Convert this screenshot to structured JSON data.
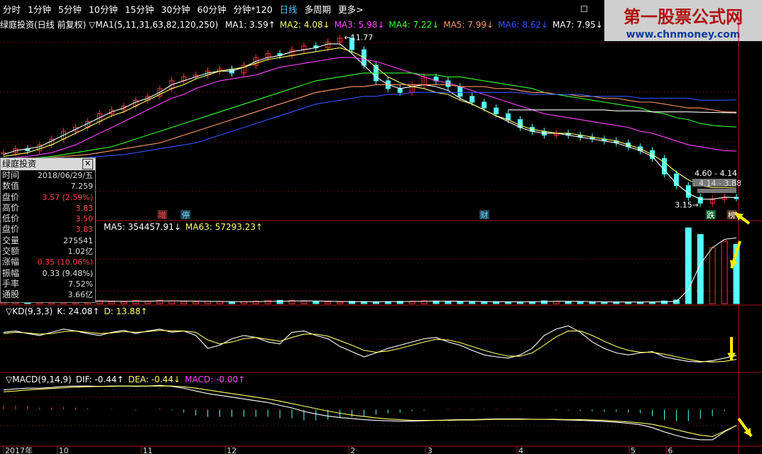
{
  "toolbar": {
    "items": [
      "分时",
      "1分钟",
      "5分钟",
      "10分钟",
      "15分钟",
      "30分钟",
      "60分钟",
      "分钟*120",
      "日线",
      "多周期",
      "更多>"
    ],
    "active": "日线"
  },
  "watermark": {
    "line1": "第一股票公式网",
    "line2": "www.chnmoney.com"
  },
  "main_header": {
    "title": "绿庭投资(日线 前复权)",
    "params": "MA1(5,11,31,63,82,120,250)",
    "ma_labels": [
      {
        "text": "MA1: 3.59↑",
        "color": "#ffffff"
      },
      {
        "text": "MA2: 4.08↓",
        "color": "#ffff66"
      },
      {
        "text": "MA3: 5.98↓",
        "color": "#ff44ff"
      },
      {
        "text": "MA4: 7.22↓",
        "color": "#33ff33"
      },
      {
        "text": "MA5: 7.99↓",
        "color": "#ff9966"
      },
      {
        "text": "MA6: 8.62↓",
        "color": "#3355ff"
      },
      {
        "text": "MA7: 7.95↓",
        "color": "#ffffff"
      }
    ]
  },
  "price_annotations": {
    "high": "11.77",
    "low": "3.15",
    "zone1": "4.60 - 4.14",
    "zone2": "4.14 - 3.88"
  },
  "events": [
    {
      "text": "增",
      "color": "#ff4444",
      "bg": "#552222",
      "x": 3.4
    },
    {
      "text": "停",
      "color": "#66ddff",
      "bg": "#224455",
      "x": 3.9
    },
    {
      "text": "财",
      "color": "#66ddff",
      "bg": "#224455",
      "x": 10.3
    },
    {
      "text": "跌",
      "color": "#ffffff",
      "bg": "#116633",
      "x": 15.15
    },
    {
      "text": "榜",
      "color": "#ffffff",
      "bg": "#553322",
      "x": 15.6
    }
  ],
  "infobox": {
    "title": "绿庭投资",
    "rows": [
      {
        "label": "时间",
        "value": "2018/06/29/五",
        "red": false
      },
      {
        "label": "数值",
        "value": "7.259",
        "red": false
      },
      {
        "label": "盘价",
        "value": "3.57 (2.59%)",
        "red": true
      },
      {
        "label": "高价",
        "value": "3.83",
        "red": true
      },
      {
        "label": "低价",
        "value": "3.50",
        "red": true
      },
      {
        "label": "盘价",
        "value": "3.83",
        "red": true
      },
      {
        "label": "交量",
        "value": "275541",
        "red": false
      },
      {
        "label": "交额",
        "value": "1.02亿",
        "red": false
      },
      {
        "label": "涨幅",
        "value": "0.35 (10.06%)",
        "red": true
      },
      {
        "label": "振幅",
        "value": "0.33 (9.48%)",
        "red": false
      },
      {
        "label": "手率",
        "value": "7.52%",
        "red": false
      },
      {
        "label": "通股",
        "value": "3.66亿",
        "red": false
      }
    ]
  },
  "volume_header": {
    "labels": [
      {
        "text": "MA5: 354457.91↓",
        "color": "#ffffff"
      },
      {
        "text": "MA63: 57293.23↑",
        "color": "#ffff66"
      }
    ]
  },
  "kd_header": {
    "labels": [
      {
        "text": "▽KD(9,3,3)",
        "color": "#ffffff"
      },
      {
        "text": "K: 24.08↑",
        "color": "#ffffff"
      },
      {
        "text": "D: 13.88↑",
        "color": "#ffff66"
      }
    ]
  },
  "macd_header": {
    "labels": [
      {
        "text": "▽MACD(9,14,9)",
        "color": "#ffffff"
      },
      {
        "text": "DIF: -0.44↑",
        "color": "#ffffff"
      },
      {
        "text": "DEA: -0.44↓",
        "color": "#ffff66"
      },
      {
        "text": "MACD: -0.00↑",
        "color": "#ff44ff"
      }
    ]
  },
  "chart_data": {
    "type": "line",
    "x_ticks": [
      "2017年",
      "10",
      "11",
      "12",
      "2",
      "3",
      "4",
      "5",
      "6"
    ],
    "x_tick_positions": [
      0,
      1.0,
      2.55,
      3.2,
      4.1,
      5.2,
      6.85,
      8.55,
      10.2,
      11.9,
      13.6
    ],
    "price": {
      "close": [
        5.9,
        6.1,
        6.0,
        6.3,
        6.6,
        7.0,
        7.2,
        7.5,
        7.9,
        8.1,
        8.3,
        8.6,
        8.8,
        9.2,
        9.6,
        9.8,
        9.9,
        10.1,
        10.2,
        10.0,
        10.4,
        10.8,
        11.0,
        10.9,
        11.2,
        11.4,
        11.3,
        11.6,
        11.8,
        11.2,
        10.4,
        9.6,
        9.2,
        9.0,
        9.4,
        9.8,
        9.6,
        9.3,
        8.8,
        8.5,
        8.2,
        7.9,
        7.6,
        7.2,
        7.0,
        6.8,
        6.9,
        6.8,
        6.7,
        6.6,
        6.5,
        6.4,
        6.2,
        6.0,
        5.6,
        4.8,
        4.2,
        3.6,
        3.3,
        3.5,
        3.6,
        3.57
      ],
      "ma1": [
        5.8,
        6.0,
        6.1,
        6.2,
        6.5,
        6.8,
        7.1,
        7.4,
        7.7,
        8.0,
        8.2,
        8.5,
        8.7,
        9.0,
        9.4,
        9.6,
        9.8,
        10.0,
        10.1,
        10.1,
        10.3,
        10.6,
        10.8,
        10.9,
        11.1,
        11.2,
        11.3,
        11.5,
        11.5,
        11.0,
        10.4,
        9.8,
        9.4,
        9.2,
        9.3,
        9.4,
        9.3,
        9.1,
        8.7,
        8.4,
        8.1,
        7.8,
        7.5,
        7.2,
        7.0,
        6.9,
        6.9,
        6.8,
        6.7,
        6.6,
        6.5,
        6.4,
        6.2,
        6.0,
        5.7,
        5.0,
        4.3,
        3.8,
        3.5,
        3.5,
        3.6,
        3.59
      ],
      "ma2": [
        5.7,
        5.8,
        5.9,
        6.1,
        6.3,
        6.6,
        6.9,
        7.2,
        7.5,
        7.8,
        8.0,
        8.3,
        8.6,
        8.9,
        9.2,
        9.4,
        9.7,
        9.9,
        10.1,
        10.2,
        10.3,
        10.5,
        10.7,
        10.8,
        10.9,
        11.0,
        11.1,
        11.2,
        11.3,
        11.1,
        10.8,
        10.3,
        9.8,
        9.5,
        9.3,
        9.2,
        9.0,
        8.9,
        8.6,
        8.4,
        8.1,
        7.8,
        7.6,
        7.3,
        7.1,
        7.0,
        6.9,
        6.9,
        6.8,
        6.7,
        6.6,
        6.5,
        6.3,
        6.1,
        5.8,
        5.4,
        4.9,
        4.5,
        4.2,
        4.1,
        4.1,
        4.08
      ],
      "ma3": [
        5.6,
        5.65,
        5.7,
        5.8,
        5.9,
        6.1,
        6.3,
        6.6,
        6.9,
        7.2,
        7.5,
        7.8,
        8.1,
        8.4,
        8.7,
        8.9,
        9.2,
        9.4,
        9.6,
        9.7,
        9.8,
        9.9,
        10.1,
        10.3,
        10.4,
        10.5,
        10.6,
        10.7,
        10.8,
        10.8,
        10.7,
        10.6,
        10.4,
        10.2,
        10.0,
        9.8,
        9.6,
        9.5,
        9.3,
        9.1,
        8.9,
        8.7,
        8.5,
        8.3,
        8.1,
        7.9,
        7.8,
        7.7,
        7.6,
        7.5,
        7.4,
        7.3,
        7.2,
        7.0,
        6.9,
        6.7,
        6.5,
        6.3,
        6.2,
        6.1,
        6.0,
        5.98
      ],
      "ma4": [
        5.5,
        5.55,
        5.6,
        5.65,
        5.7,
        5.8,
        5.9,
        6.0,
        6.1,
        6.2,
        6.4,
        6.6,
        6.8,
        7.0,
        7.2,
        7.4,
        7.6,
        7.8,
        8.0,
        8.2,
        8.4,
        8.6,
        8.8,
        9.0,
        9.2,
        9.4,
        9.6,
        9.7,
        9.8,
        9.9,
        10.0,
        10.0,
        10.0,
        10.0,
        10.0,
        9.9,
        9.9,
        9.8,
        9.8,
        9.7,
        9.6,
        9.5,
        9.4,
        9.3,
        9.2,
        9.0,
        8.9,
        8.8,
        8.7,
        8.6,
        8.5,
        8.4,
        8.3,
        8.2,
        8.0,
        7.9,
        7.7,
        7.6,
        7.4,
        7.3,
        7.25,
        7.22
      ],
      "ma5": [
        5.5,
        5.52,
        5.55,
        5.6,
        5.65,
        5.7,
        5.75,
        5.8,
        5.9,
        6.0,
        6.1,
        6.2,
        6.3,
        6.4,
        6.6,
        6.8,
        7.0,
        7.2,
        7.4,
        7.6,
        7.8,
        8.0,
        8.2,
        8.4,
        8.6,
        8.8,
        9.0,
        9.1,
        9.2,
        9.3,
        9.3,
        9.4,
        9.4,
        9.4,
        9.4,
        9.4,
        9.4,
        9.4,
        9.3,
        9.3,
        9.3,
        9.2,
        9.2,
        9.1,
        9.0,
        9.0,
        8.9,
        8.9,
        8.8,
        8.8,
        8.7,
        8.7,
        8.6,
        8.5,
        8.5,
        8.4,
        8.3,
        8.2,
        8.2,
        8.1,
        8.0,
        7.99
      ],
      "ma6": [
        5.4,
        5.42,
        5.45,
        5.48,
        5.5,
        5.55,
        5.6,
        5.65,
        5.7,
        5.75,
        5.8,
        5.9,
        6.0,
        6.1,
        6.2,
        6.3,
        6.4,
        6.6,
        6.8,
        7.0,
        7.2,
        7.4,
        7.6,
        7.8,
        8.0,
        8.2,
        8.4,
        8.5,
        8.6,
        8.7,
        8.8,
        8.8,
        8.9,
        8.9,
        9.0,
        9.0,
        9.0,
        9.0,
        9.0,
        9.0,
        9.0,
        9.0,
        9.0,
        9.0,
        8.9,
        8.9,
        8.9,
        8.9,
        8.9,
        8.8,
        8.8,
        8.8,
        8.8,
        8.7,
        8.7,
        8.7,
        8.7,
        8.7,
        8.6,
        8.6,
        8.6,
        8.62
      ],
      "ma7": [
        null,
        null,
        null,
        null,
        null,
        null,
        null,
        null,
        null,
        null,
        null,
        null,
        null,
        null,
        null,
        null,
        null,
        null,
        null,
        null,
        null,
        null,
        null,
        null,
        null,
        null,
        null,
        null,
        null,
        null,
        null,
        null,
        null,
        null,
        null,
        null,
        null,
        null,
        null,
        null,
        null,
        null,
        8.1,
        8.1,
        8.1,
        8.1,
        8.1,
        8.1,
        8.1,
        8.1,
        8.1,
        8.05,
        8.05,
        8.05,
        8.0,
        8.0,
        8.0,
        8.0,
        7.98,
        7.97,
        7.96,
        7.95
      ]
    },
    "price_ylim": [
      2.8,
      12.3
    ],
    "volume": [
      95,
      90,
      88,
      60,
      70,
      75,
      65,
      80,
      85,
      60,
      55,
      95,
      70,
      100,
      85,
      60,
      55,
      65,
      70,
      55,
      60,
      75,
      90,
      100,
      95,
      70,
      60,
      55,
      50,
      70,
      65,
      55,
      60,
      70,
      75,
      85,
      80,
      60,
      55,
      50,
      65,
      60,
      55,
      50,
      60,
      85,
      70,
      55,
      50,
      45,
      50,
      55,
      45,
      50,
      55,
      80,
      110,
      2300,
      2100,
      1700,
      1900,
      1800
    ],
    "volume_ma5": [
      80,
      82,
      80,
      78,
      70,
      72,
      74,
      72,
      76,
      75,
      70,
      75,
      76,
      80,
      82,
      80,
      75,
      68,
      64,
      62,
      60,
      62,
      66,
      72,
      78,
      84,
      82,
      74,
      64,
      60,
      60,
      61,
      62,
      63,
      65,
      70,
      75,
      76,
      73,
      68,
      62,
      58,
      56,
      55,
      56,
      62,
      68,
      70,
      68,
      60,
      54,
      50,
      50,
      50,
      51,
      56,
      66,
      420,
      1200,
      1700,
      1950,
      2000
    ],
    "volume_ylim": [
      0,
      2500
    ],
    "kd_k": [
      60,
      62,
      58,
      55,
      60,
      65,
      62,
      58,
      55,
      60,
      63,
      58,
      62,
      65,
      60,
      62,
      55,
      35,
      40,
      50,
      55,
      52,
      45,
      42,
      60,
      62,
      55,
      50,
      38,
      30,
      22,
      28,
      35,
      40,
      45,
      50,
      52,
      45,
      40,
      32,
      25,
      22,
      20,
      25,
      35,
      55,
      65,
      70,
      60,
      45,
      35,
      28,
      25,
      28,
      30,
      22,
      18,
      15,
      14,
      16,
      20,
      24
    ],
    "kd_d": [
      58,
      60,
      59,
      57,
      58,
      61,
      62,
      60,
      58,
      59,
      61,
      60,
      61,
      63,
      62,
      62,
      60,
      48,
      42,
      45,
      50,
      52,
      49,
      46,
      52,
      57,
      57,
      54,
      47,
      40,
      32,
      29,
      31,
      35,
      40,
      45,
      49,
      48,
      44,
      38,
      32,
      27,
      23,
      23,
      28,
      40,
      53,
      62,
      62,
      55,
      46,
      38,
      32,
      29,
      29,
      26,
      22,
      18,
      15,
      14,
      15,
      18
    ],
    "kd_ylim": [
      0,
      100
    ],
    "macd_dif": [
      0.55,
      0.58,
      0.6,
      0.6,
      0.62,
      0.65,
      0.66,
      0.66,
      0.65,
      0.66,
      0.66,
      0.65,
      0.66,
      0.68,
      0.65,
      0.6,
      0.52,
      0.45,
      0.4,
      0.35,
      0.3,
      0.25,
      0.2,
      0.12,
      0.05,
      -0.05,
      -0.12,
      -0.18,
      -0.22,
      -0.25,
      -0.28,
      -0.3,
      -0.31,
      -0.32,
      -0.32,
      -0.31,
      -0.3,
      -0.29,
      -0.28,
      -0.28,
      -0.27,
      -0.26,
      -0.26,
      -0.26,
      -0.27,
      -0.27,
      -0.28,
      -0.29,
      -0.3,
      -0.31,
      -0.33,
      -0.35,
      -0.38,
      -0.42,
      -0.5,
      -0.62,
      -0.72,
      -0.8,
      -0.84,
      -0.84,
      -0.62,
      -0.44
    ],
    "macd_dea": [
      0.5,
      0.52,
      0.55,
      0.57,
      0.59,
      0.61,
      0.63,
      0.64,
      0.65,
      0.65,
      0.66,
      0.66,
      0.66,
      0.66,
      0.66,
      0.64,
      0.6,
      0.55,
      0.5,
      0.45,
      0.4,
      0.35,
      0.3,
      0.24,
      0.17,
      0.1,
      0.03,
      -0.04,
      -0.1,
      -0.15,
      -0.19,
      -0.23,
      -0.26,
      -0.28,
      -0.3,
      -0.3,
      -0.3,
      -0.3,
      -0.29,
      -0.29,
      -0.28,
      -0.27,
      -0.27,
      -0.27,
      -0.27,
      -0.27,
      -0.27,
      -0.28,
      -0.28,
      -0.29,
      -0.3,
      -0.32,
      -0.34,
      -0.37,
      -0.41,
      -0.48,
      -0.56,
      -0.64,
      -0.71,
      -0.75,
      -0.6,
      -0.44
    ],
    "macd_ylim": [
      -1.0,
      1.0
    ]
  }
}
